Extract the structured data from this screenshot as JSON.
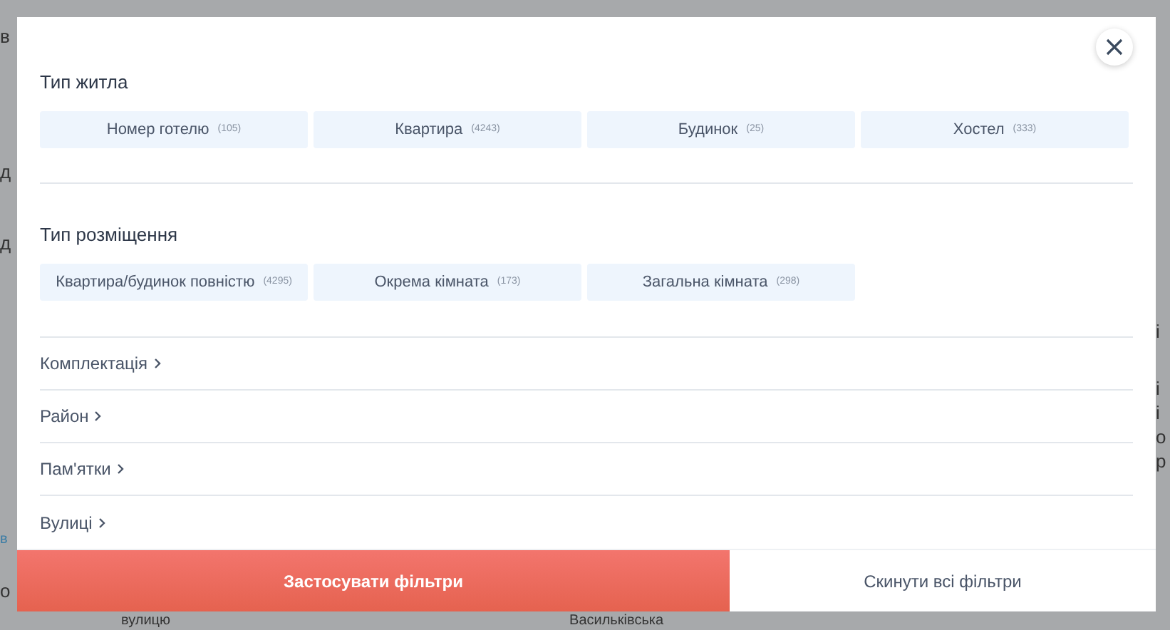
{
  "background": {
    "left_fragments": [
      {
        "text": "в"
      },
      {
        "text": "д"
      },
      {
        "text": "д"
      },
      {
        "text": "в",
        "kind": "link"
      },
      {
        "text": "о"
      }
    ],
    "right_fragments": [
      {
        "text": "і"
      },
      {
        "text": "і"
      },
      {
        "text": "і"
      },
      {
        "text": "о"
      },
      {
        "text": "р"
      }
    ],
    "bottom_texts": [
      "вулицю",
      "Васильківська"
    ]
  },
  "modal": {
    "sections": [
      {
        "title": "Тип житла",
        "options": [
          {
            "label": "Номер готелю",
            "count": "(105)"
          },
          {
            "label": "Квартира",
            "count": "(4243)"
          },
          {
            "label": "Будинок",
            "count": "(25)"
          },
          {
            "label": "Хостел",
            "count": "(333)"
          }
        ]
      },
      {
        "title": "Тип розміщення",
        "options": [
          {
            "label": "Квартира/будинок повністю",
            "count": "(4295)"
          },
          {
            "label": "Окрема кімната",
            "count": "(173)"
          },
          {
            "label": "Загальна кімната",
            "count": "(298)"
          }
        ]
      }
    ],
    "expandable": [
      {
        "label": "Комплектація"
      },
      {
        "label": "Район"
      },
      {
        "label": "Пам'ятки"
      },
      {
        "label": "Вулиці"
      }
    ],
    "apply_button": "Застосувати фільтри",
    "reset_button": "Скинути всі фільтри"
  }
}
